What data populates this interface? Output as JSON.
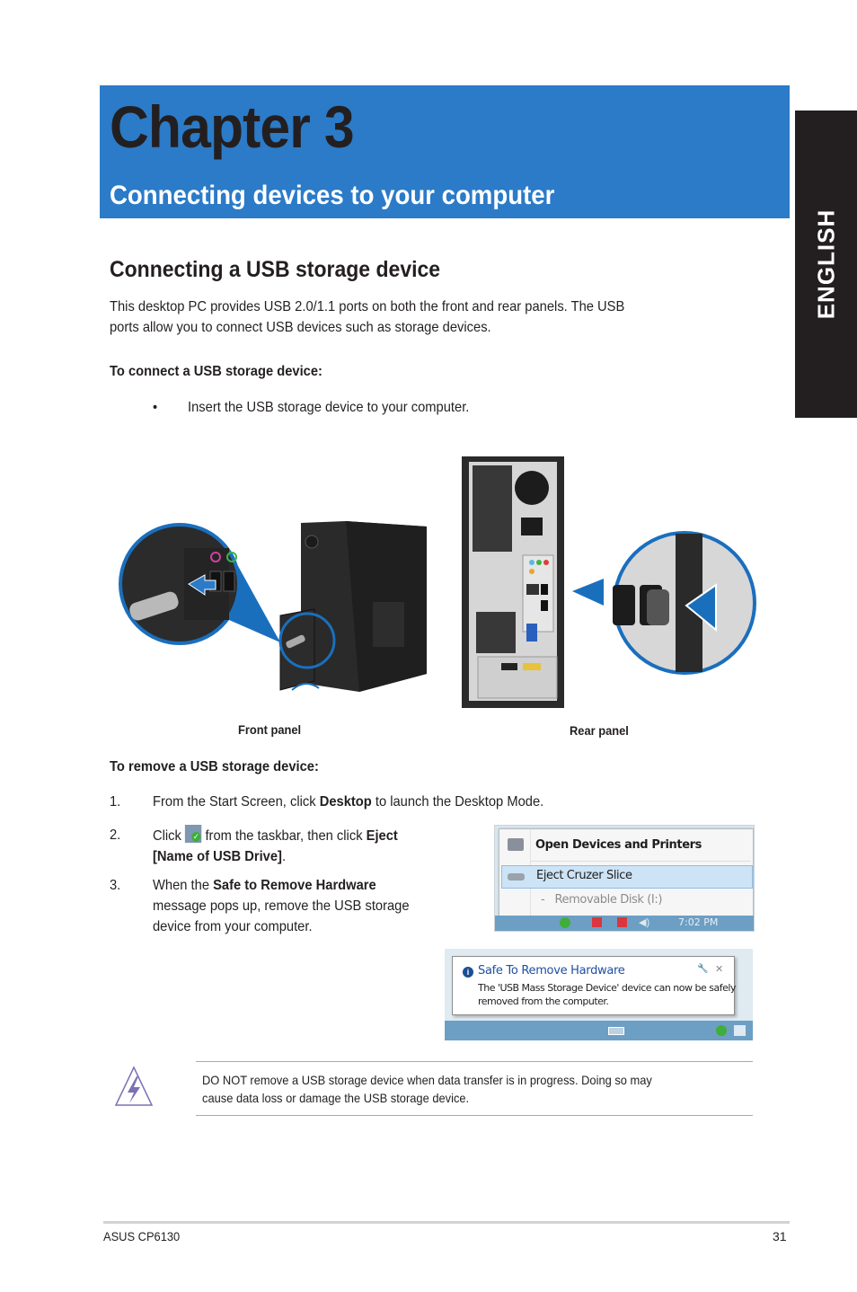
{
  "header": {
    "chapter_title": "Chapter 3",
    "chapter_subtitle": "Connecting devices to your computer",
    "language_tab": "ENGLISH"
  },
  "section": {
    "title": "Connecting a USB storage device",
    "intro_line1": "This desktop PC provides USB 2.0/1.1 ports on both the front and rear panels. The USB",
    "intro_line2": "ports allow you to connect USB devices such as storage devices.",
    "connect_heading": "To connect a USB storage device:",
    "connect_bullet_symbol": "•",
    "connect_bullet_text": "Insert the USB storage device to your computer.",
    "figures": {
      "front_label": "Front panel",
      "rear_label": "Rear panel"
    },
    "remove_heading": "To remove a USB storage device:",
    "steps": [
      {
        "num": "1.",
        "pre": "From the Start Screen, click ",
        "bold": "Desktop",
        "post": " to launch the Desktop Mode."
      },
      {
        "num": "2.",
        "pre": "Click ",
        "icon": "safely-remove-hardware-icon",
        "mid": " from the taskbar, then click ",
        "bold": "Eject",
        "line2_bold": "[Name of USB Drive]",
        "line2_post": "."
      },
      {
        "num": "3.",
        "pre": "When the ",
        "bold": "Safe to Remove Hardware",
        "line2": "message pops up, remove the USB storage",
        "line3": "device from your computer."
      }
    ]
  },
  "screenshot_menu": {
    "items": [
      {
        "label": "Open Devices and Printers",
        "icon": "printer-icon"
      },
      {
        "label": "Eject Cruzer Slice",
        "icon": "drive-icon",
        "highlighted": true
      },
      {
        "label": "-   Removable Disk (I:)",
        "disabled": true
      }
    ],
    "clock": "7:02 PM"
  },
  "screenshot_notification": {
    "title": "Safe To Remove Hardware",
    "message_line1": "The 'USB Mass Storage Device' device can now be safely",
    "message_line2": "removed from the computer.",
    "close_symbol": "✕"
  },
  "warning_note": {
    "line1": "DO NOT remove a USB storage device when data transfer is in progress. Doing so may",
    "line2": "cause data loss or damage the USB storage device."
  },
  "footer": {
    "model": "ASUS CP6130",
    "page_number": "31"
  },
  "colors": {
    "banner_blue": "#2b7bc8",
    "dark": "#231f20",
    "highlight": "#cde3f6"
  }
}
